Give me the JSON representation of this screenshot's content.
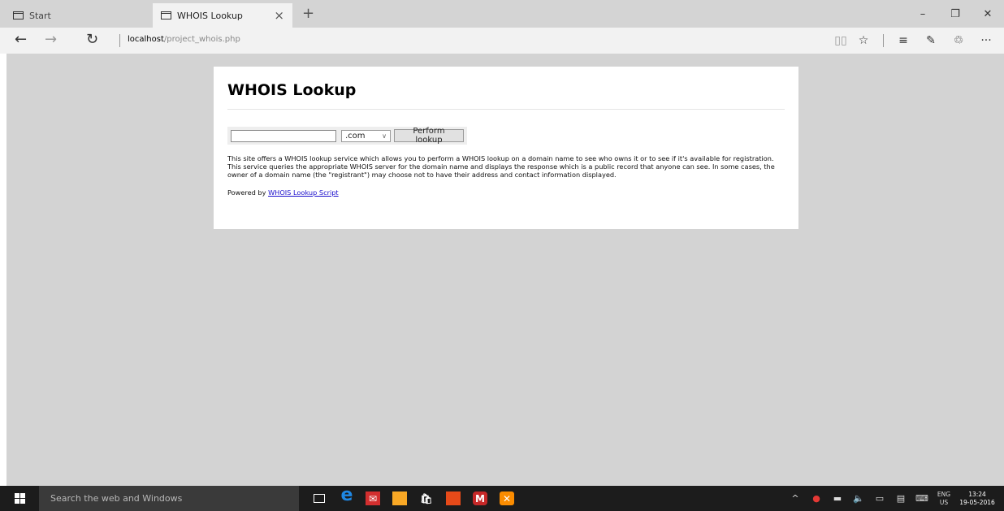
{
  "browser": {
    "tabs": [
      {
        "label": "Start",
        "active": false
      },
      {
        "label": "WHOIS Lookup",
        "active": true
      }
    ],
    "new_tab": "+",
    "tab_close": "×",
    "window_controls": {
      "minimize": "–",
      "restore": "❐",
      "close": "✕"
    },
    "nav": {
      "back": "←",
      "forward": "→",
      "refresh": "↻"
    },
    "url_host": "localhost",
    "url_path": "/project_whois.php",
    "toolbar": {
      "reading_view": "▯▯",
      "favorite": "☆",
      "hub": "≡",
      "note": "✎",
      "share": "♲",
      "more": "···"
    }
  },
  "page": {
    "title": "WHOIS Lookup",
    "domain_input_value": "",
    "tld_selected": ".com",
    "lookup_button_label": "Perform lookup",
    "description": "This site offers a WHOIS lookup service which allows you to perform a WHOIS lookup on a domain name to see who owns it or to see if it's available for registration. This service queries the appropriate WHOIS server for the domain name and displays the response which is a public record that anyone can see. In some cases, the owner of a domain name (the \"registrant\") may choose not to have their address and contact information displayed.",
    "powered_prefix": "Powered by ",
    "powered_link": "WHOIS Lookup Script"
  },
  "taskbar": {
    "search_placeholder": "Search the web and Windows",
    "language_top": "ENG",
    "language_bottom": "US",
    "time": "13:24",
    "date": "19-05-2016"
  },
  "colors": {
    "page_background": "#d3d3d3",
    "card_background": "#ffffff",
    "link": "#1a0dcc",
    "taskbar": "#1c1c1c",
    "edge_blue": "#1e88e5",
    "mail_red": "#d32f2f",
    "explorer_yellow": "#f9a825",
    "acrobat_red": "#e64a19",
    "mcafee_red": "#c62828",
    "xampp_orange": "#fb8c00"
  }
}
